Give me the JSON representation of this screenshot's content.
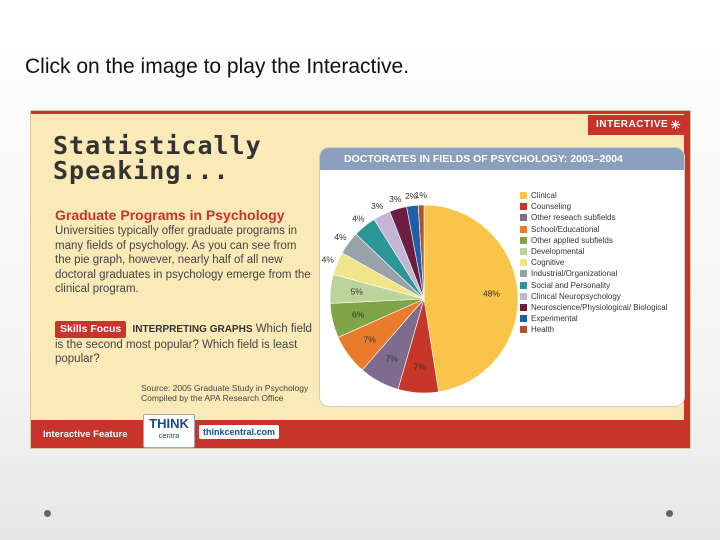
{
  "slide": {
    "instruction": "Click on the image to play the Interactive."
  },
  "card": {
    "interactive_label": "INTERACTIVE",
    "title_line1": "Statistically",
    "title_line2": "Speaking...",
    "heading": "Graduate Programs in Psychology",
    "body": "Universities typically offer graduate programs in many fields of psychology. As you can see from the pie graph, however, nearly half of all new doctoral graduates in psychology emerge from the clinical program.",
    "skills_badge": "Skills Focus",
    "skills_caps": "INTERPRETING GRAPHS",
    "skills_question": "Which field is the second most popular? Which field is least popular?",
    "source_line1": "Source: 2005 Graduate Study in Psychology",
    "source_line2": "Compiled by the APA Research Office",
    "footer_label": "Interactive Feature",
    "logo_text": "THINK",
    "logo_sub": "centra",
    "link_text": "thinkcentral.com"
  },
  "chart_data": {
    "type": "pie",
    "title": "DOCTORATES IN FIELDS OF PSYCHOLOGY: 2003–2004",
    "slices": [
      {
        "label": "Clinical",
        "value": 48,
        "color": "#f8c44a"
      },
      {
        "label": "Counseling",
        "value": 7,
        "color": "#c8362a"
      },
      {
        "label": "Other reseach subfields",
        "value": 7,
        "color": "#7e6b8e"
      },
      {
        "label": "School/Educational",
        "value": 7,
        "color": "#e97b2c"
      },
      {
        "label": "Other applied subfields",
        "value": 6,
        "color": "#7fa547"
      },
      {
        "label": "Developmental",
        "value": 5,
        "color": "#bcd49a"
      },
      {
        "label": "Cognitive",
        "value": 4,
        "color": "#f0e58a"
      },
      {
        "label": "Industrial/Organizational",
        "value": 4,
        "color": "#9aa2a9"
      },
      {
        "label": "Social and Personality",
        "value": 4,
        "color": "#2b9597"
      },
      {
        "label": "Clinical Neuropsychology",
        "value": 3,
        "color": "#c3b6d3"
      },
      {
        "label": "Neuroscience/Physiological/ Biological",
        "value": 3,
        "color": "#6b1e3f"
      },
      {
        "label": "Experimental",
        "value": 2,
        "color": "#1f5ea8"
      },
      {
        "label": "Health",
        "value": 1,
        "color": "#b3512a"
      }
    ],
    "label_suffix": "%"
  }
}
